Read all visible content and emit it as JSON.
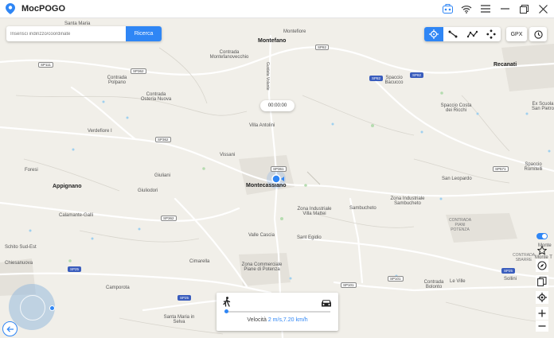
{
  "app": {
    "title": "MocPOGO"
  },
  "search": {
    "placeholder": "Inserisci indirizzo/coordinate",
    "button": "Ricerca"
  },
  "toolbar": {
    "gpx": "GPX"
  },
  "timer": "00:00:00",
  "speed": {
    "label": "Velocità",
    "value": "2 m/s,7.20 km/h",
    "level": 0.02
  },
  "colors": {
    "accent": "#2f86f5",
    "map_bg": "#f1efe9",
    "water": "#9fd0ef"
  },
  "icons": {
    "titlebar": [
      "toolbox-icon",
      "wifi-icon",
      "menu-icon",
      "minimize-icon",
      "restore-icon",
      "close-icon"
    ],
    "modes": [
      "teleport-icon",
      "two-spot-icon",
      "multi-spot-icon",
      "joystick-icon"
    ],
    "right": [
      "toggle-icon",
      "favorite-icon",
      "compass-icon",
      "copy-icon",
      "locate-icon",
      "zoom-in-icon",
      "zoom-out-icon"
    ]
  },
  "map": {
    "places": [
      {
        "text": "Santa Maria",
        "cls": "lbl"
      },
      {
        "text": "Montefiore",
        "cls": "lbl"
      },
      {
        "text": "Montefano",
        "cls": "lbl town"
      },
      {
        "text": "Contrada Montefanovecchio",
        "cls": "lbl zone"
      },
      {
        "text": "Contrada Polpano",
        "cls": "lbl zone"
      },
      {
        "text": "Contrada Osteria Nuova",
        "cls": "lbl zone"
      },
      {
        "text": "Recanati",
        "cls": "lbl town"
      },
      {
        "text": "Spaccio Bacucco",
        "cls": "lbl zone"
      },
      {
        "text": "Spaccio Costa dei Ricchi",
        "cls": "lbl zone"
      },
      {
        "text": "Ex Scuola San Pietro",
        "cls": "lbl zone"
      },
      {
        "text": "Verdefiore I",
        "cls": "lbl"
      },
      {
        "text": "Villa Antolini",
        "cls": "lbl"
      },
      {
        "text": "Vissani",
        "cls": "lbl"
      },
      {
        "text": "Foresi",
        "cls": "lbl"
      },
      {
        "text": "Giuliani",
        "cls": "lbl"
      },
      {
        "text": "San Leopardo",
        "cls": "lbl"
      },
      {
        "text": "Spaccio Romitelli",
        "cls": "lbl zone"
      },
      {
        "text": "Appignano",
        "cls": "lbl town"
      },
      {
        "text": "Giuliodori",
        "cls": "lbl"
      },
      {
        "text": "Montecassiano",
        "cls": "lbl town"
      },
      {
        "text": "Zona Industriale Villa Mattei",
        "cls": "lbl zone"
      },
      {
        "text": "Sambucheto",
        "cls": "lbl"
      },
      {
        "text": "Zona Industriale Sambucheto",
        "cls": "lbl zone"
      },
      {
        "text": "Calamante-Galli",
        "cls": "lbl"
      },
      {
        "text": "CONTRADA PIANI POTENZA",
        "cls": "lbl zone"
      },
      {
        "text": "Valle Cascia",
        "cls": "lbl"
      },
      {
        "text": "Sant Egidio",
        "cls": "lbl"
      },
      {
        "text": "Schito Sud-Est",
        "cls": "lbl"
      },
      {
        "text": "Chiesanuova",
        "cls": "lbl"
      },
      {
        "text": "Cimarella",
        "cls": "lbl"
      },
      {
        "text": "Zona Commerciale Piane di Potenza",
        "cls": "lbl zone"
      },
      {
        "text": "CONTRADA SBARRE",
        "cls": "lbl zone"
      },
      {
        "text": "Camporota",
        "cls": "lbl"
      },
      {
        "text": "Contrada Bolonto",
        "cls": "lbl zone"
      },
      {
        "text": "Le Ville",
        "cls": "lbl"
      },
      {
        "text": "Sollini",
        "cls": "lbl"
      },
      {
        "text": "Santa Maria in Selva",
        "cls": "lbl zone"
      },
      {
        "text": "Monte",
        "cls": "lbl"
      },
      {
        "text": "Monte T",
        "cls": "lbl"
      },
      {
        "text": "Guidata Volante",
        "cls": "lbl"
      }
    ],
    "roads": [
      "SP82",
      "SP111",
      "SP362",
      "SP82",
      "SP82",
      "SP362",
      "SP361",
      "SP571",
      "SP362",
      "SP101",
      "SP101",
      "SP25",
      "SP25",
      "SP25"
    ]
  }
}
